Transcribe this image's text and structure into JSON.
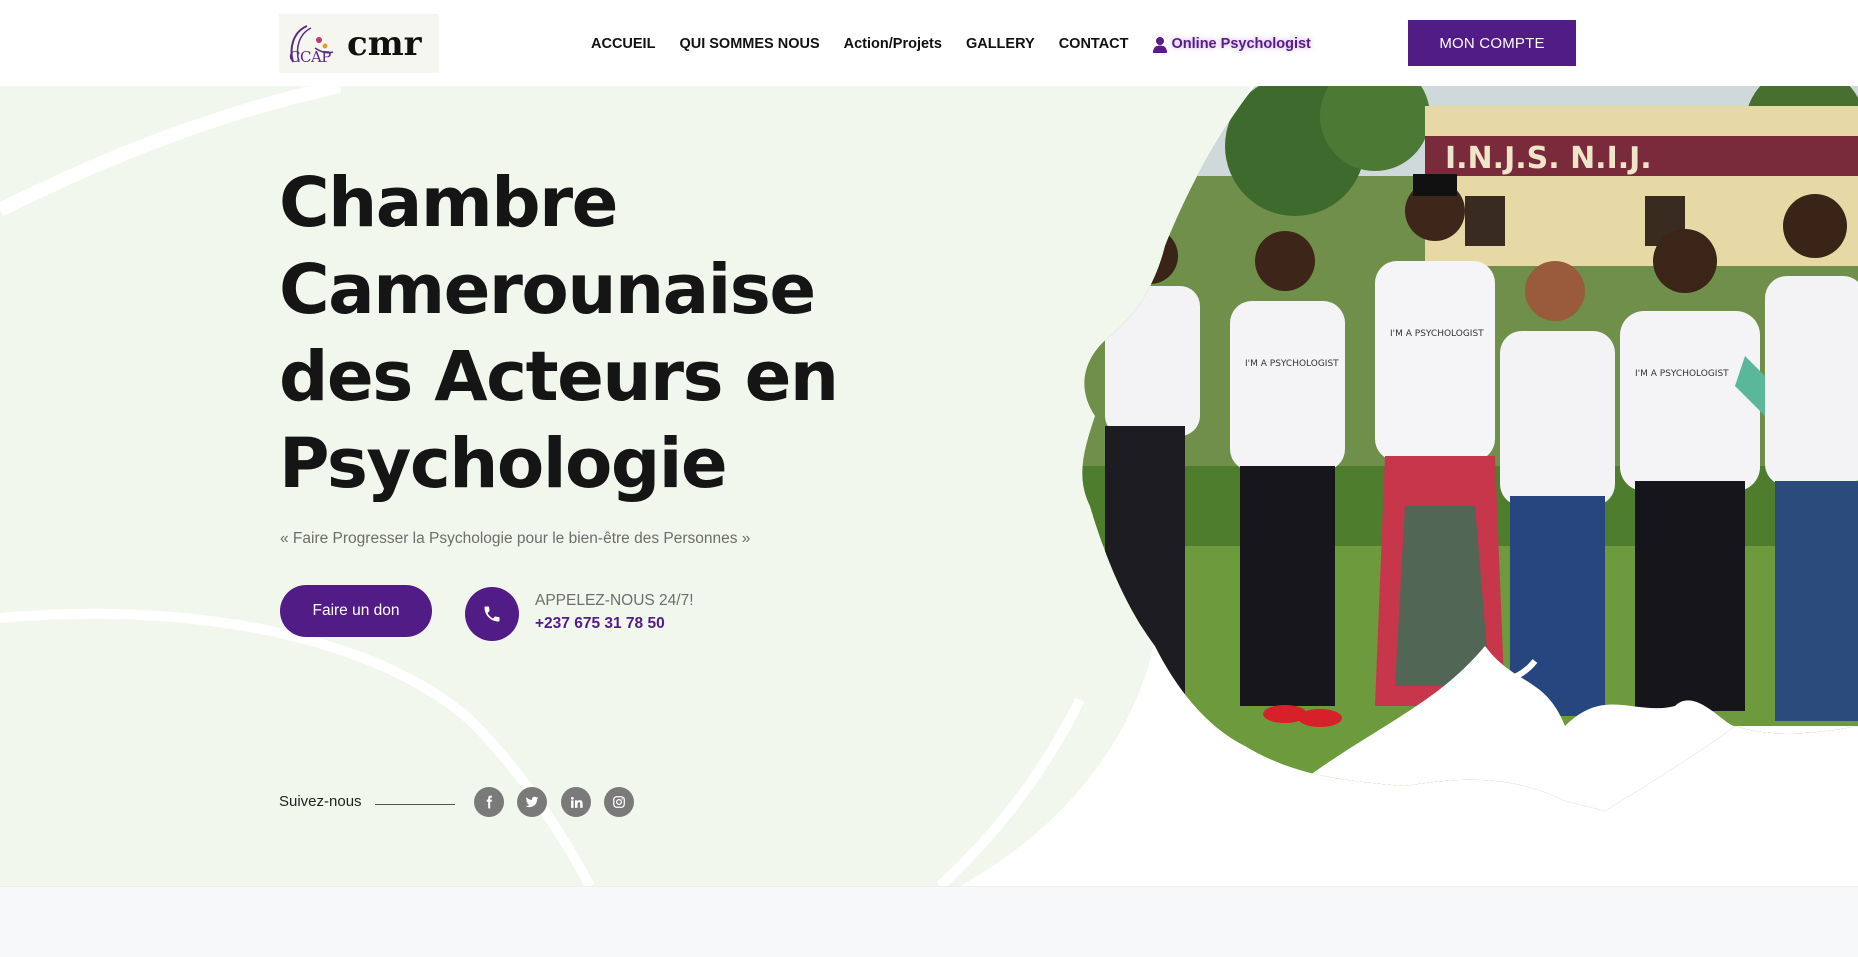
{
  "header": {
    "logo_mark_text": "CCAP",
    "logo_word": "cmr",
    "nav": [
      "ACCUEIL",
      "QUI SOMMES NOUS",
      "Action/Projets",
      "GALLERY",
      "CONTACT"
    ],
    "online_label": "Online Psychologist",
    "account_label": "MON COMPTE"
  },
  "hero": {
    "title_lines": [
      "Chambre",
      "Camerounaise",
      "des Acteurs en",
      "Psychologie"
    ],
    "tagline": "« Faire Progresser la Psychologie pour le bien-être des Personnes »",
    "donate_label": "Faire un don",
    "call_label": "APPELEZ-NOUS 24/7!",
    "call_number": "+237 675 31 78 50",
    "photo_sign_text": "I.N.J.S.   N.I.J.",
    "shirt_text": "I'M A PSYCHOLOGIST"
  },
  "social": {
    "label": "Suivez-nous",
    "icons": [
      "facebook-icon",
      "twitter-icon",
      "linkedin-icon",
      "instagram-icon"
    ]
  },
  "colors": {
    "brand_purple": "#521c86",
    "hero_tint": "#f2f7ee",
    "social_grey": "#7a7a7a",
    "text_dark": "#151515",
    "text_muted": "#6d6d6d"
  }
}
